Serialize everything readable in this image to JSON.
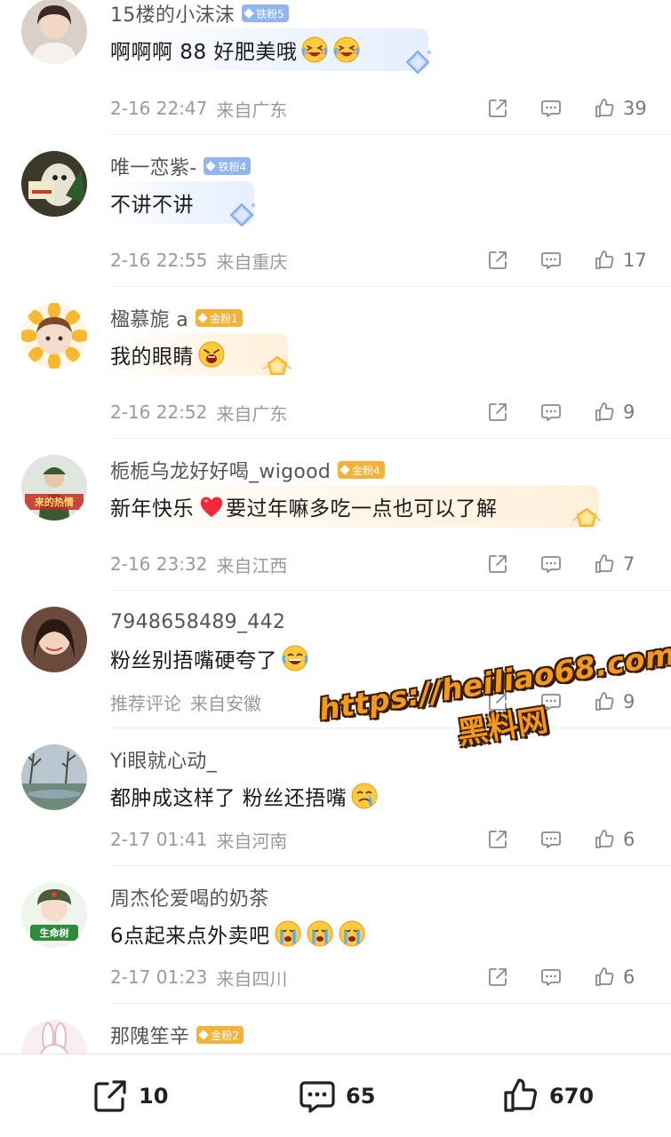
{
  "comments": [
    {
      "username": "15楼的小沫沫",
      "badge": "铁粉5",
      "badge_type": "iron",
      "text": "啊啊啊 88 好肥美哦",
      "emojis": [
        "laughing-crying-emoji",
        "laughing-crying-emoji"
      ],
      "time": "2-16 22:47",
      "location": "来自广东",
      "likes": "39"
    },
    {
      "username": "唯一恋紫-",
      "badge": "铁粉4",
      "badge_type": "iron",
      "text": "不讲不讲",
      "emojis": [],
      "time": "2-16 22:55",
      "location": "来自重庆",
      "likes": "17"
    },
    {
      "username": "楹慕旎 a",
      "badge": "金粉1",
      "badge_type": "gold",
      "text": "我的眼睛",
      "emojis": [
        "scream-emoji"
      ],
      "time": "2-16 22:52",
      "location": "来自广东",
      "likes": "9"
    },
    {
      "username": "栀栀乌龙好好喝_wigood",
      "badge": "金粉4",
      "badge_type": "gold",
      "text": "新年快乐",
      "text2": "要过年嘛多吃一点也可以了解",
      "emojis": [
        "heart-emoji"
      ],
      "time": "2-16 23:32",
      "location": "来自江西",
      "likes": "7"
    },
    {
      "username": "7948658489_442",
      "badge": "",
      "badge_type": "",
      "text": "粉丝别捂嘴硬夸了",
      "emojis": [
        "tears-of-joy-emoji"
      ],
      "time": "推荐评论",
      "location": "来自安徽",
      "likes": "9"
    },
    {
      "username": "Yi眼就心动_",
      "badge": "",
      "badge_type": "",
      "text": "都肿成这样了 粉丝还捂嘴",
      "emojis": [
        "crying-emoji"
      ],
      "time": "2-17 01:41",
      "location": "来自河南",
      "likes": "6"
    },
    {
      "username": "周杰伦爱喝的奶茶",
      "badge": "",
      "badge_type": "",
      "text": "6点起来点外卖吧",
      "emojis": [
        "sobbing-emoji",
        "sobbing-emoji",
        "sobbing-emoji"
      ],
      "time": "2-17 01:23",
      "location": "来自四川",
      "likes": "6"
    },
    {
      "username": "那隗笙辛",
      "badge": "金粉2",
      "badge_type": "gold"
    }
  ],
  "bottom_bar": {
    "share_count": "10",
    "comment_count": "65",
    "like_count": "670"
  },
  "watermark": {
    "url": "https://heiliao68.com",
    "name": "黑料网"
  },
  "colors": {
    "iron_badge": "#8fb6f2",
    "gold_badge": "#f3b33a",
    "watermark": "#f39a1d"
  }
}
